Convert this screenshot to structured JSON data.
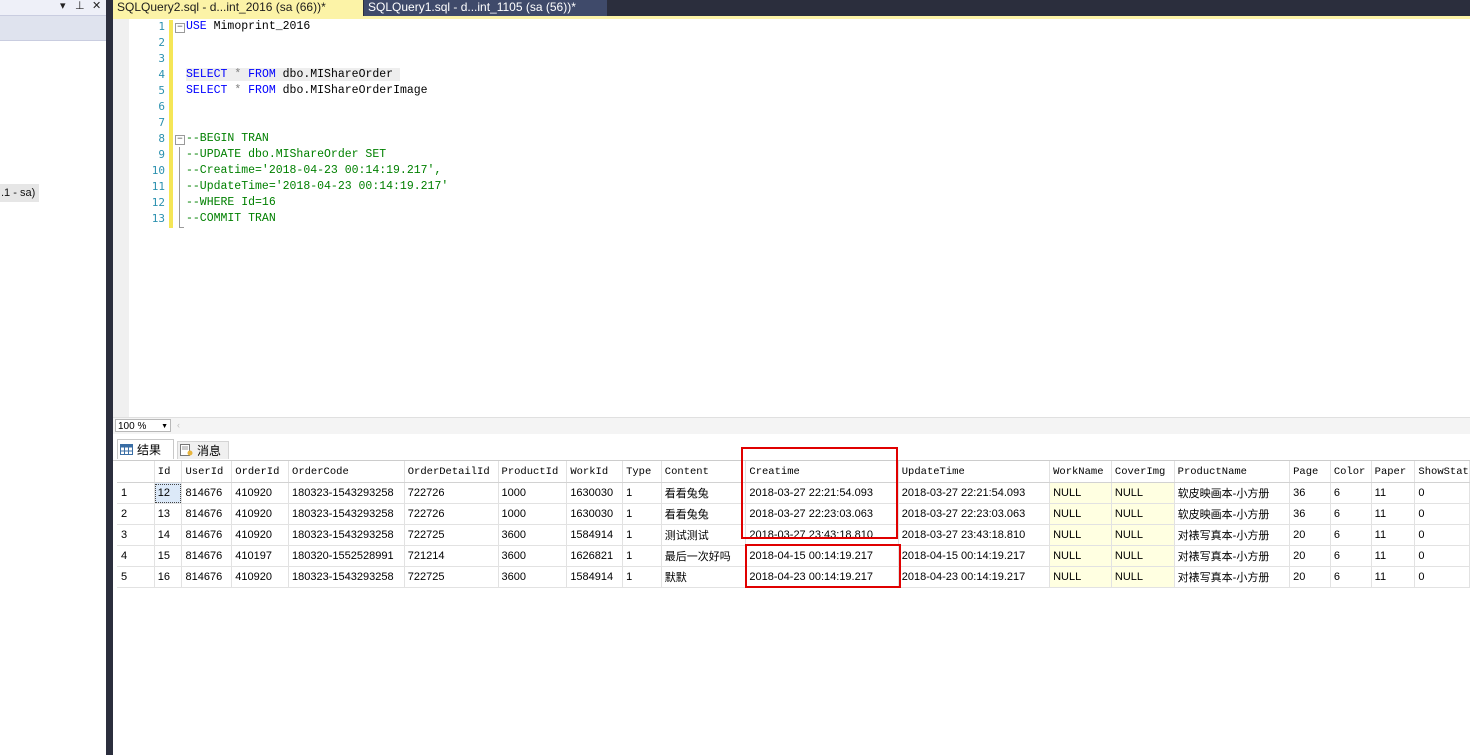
{
  "left_panel": {
    "pin_glyph": "▾ ⊥ ✕",
    "connection_node": ".1 - sa)"
  },
  "tabs": [
    {
      "label": "SQLQuery2.sql - d...int_2016 (sa (66))*",
      "active": true
    },
    {
      "label": "SQLQuery1.sql - d...int_1105 (sa (56))*",
      "active": false
    }
  ],
  "editor": {
    "line_numbers": [
      "1",
      "2",
      "3",
      "4",
      "5",
      "6",
      "7",
      "8",
      "9",
      "10",
      "11",
      "12",
      "13"
    ],
    "lines": {
      "l1": {
        "kw": "USE",
        "rest": " Mimoprint_2016"
      },
      "l4": {
        "kw1": "SELECT",
        "star": " * ",
        "kw2": "FROM",
        "rest": " dbo.MIShareOrder"
      },
      "l5": {
        "kw1": "SELECT",
        "star": " * ",
        "kw2": "FROM",
        "rest": " dbo.MIShareOrderImage"
      },
      "l8": "--BEGIN TRAN",
      "l9": "--UPDATE dbo.MIShareOrder SET",
      "l10": "--Creatime='2018-04-23 00:14:19.217',",
      "l11": "--UpdateTime='2018-04-23 00:14:19.217'",
      "l12": "--WHERE Id=16",
      "l13": "--COMMIT TRAN"
    }
  },
  "zoom": {
    "value": "100 %"
  },
  "result_tabs": {
    "results": "结果",
    "messages": "消息"
  },
  "grid": {
    "columns": [
      "Id",
      "UserId",
      "OrderId",
      "OrderCode",
      "OrderDetailId",
      "ProductId",
      "WorkId",
      "Type",
      "Content",
      "Creatime",
      "UpdateTime",
      "WorkName",
      "CoverImg",
      "ProductName",
      "Page",
      "Color",
      "Paper",
      "ShowStat"
    ],
    "rows": [
      [
        "1",
        "12",
        "814676",
        "410920",
        "180323-1543293258",
        "722726",
        "1000",
        "1630030",
        "1",
        "看看兔兔",
        "2018-03-27 22:21:54.093",
        "2018-03-27 22:21:54.093",
        "NULL",
        "NULL",
        "软皮映画本-小方册",
        "36",
        "6",
        "11",
        "0"
      ],
      [
        "2",
        "13",
        "814676",
        "410920",
        "180323-1543293258",
        "722726",
        "1000",
        "1630030",
        "1",
        "看看兔兔",
        "2018-03-27 22:23:03.063",
        "2018-03-27 22:23:03.063",
        "NULL",
        "NULL",
        "软皮映画本-小方册",
        "36",
        "6",
        "11",
        "0"
      ],
      [
        "3",
        "14",
        "814676",
        "410920",
        "180323-1543293258",
        "722725",
        "3600",
        "1584914",
        "1",
        "测试测试",
        "2018-03-27 23:43:18.810",
        "2018-03-27 23:43:18.810",
        "NULL",
        "NULL",
        "对裱写真本-小方册",
        "20",
        "6",
        "11",
        "0"
      ],
      [
        "4",
        "15",
        "814676",
        "410197",
        "180320-1552528991",
        "721214",
        "3600",
        "1626821",
        "1",
        "最后一次好吗",
        "2018-04-15 00:14:19.217",
        "2018-04-15 00:14:19.217",
        "NULL",
        "NULL",
        "对裱写真本-小方册",
        "20",
        "6",
        "11",
        "0"
      ],
      [
        "5",
        "16",
        "814676",
        "410920",
        "180323-1543293258",
        "722725",
        "3600",
        "1584914",
        "1",
        "默默",
        "2018-04-23 00:14:19.217",
        "2018-04-23 00:14:19.217",
        "NULL",
        "NULL",
        "对裱写真本-小方册",
        "20",
        "6",
        "11",
        "0"
      ]
    ]
  },
  "colors": {
    "tab_active": "#fcf3a7",
    "tab_strip": "#2b2e3d",
    "highlight": "#e00000",
    "null_cell": "#ffffe1"
  }
}
